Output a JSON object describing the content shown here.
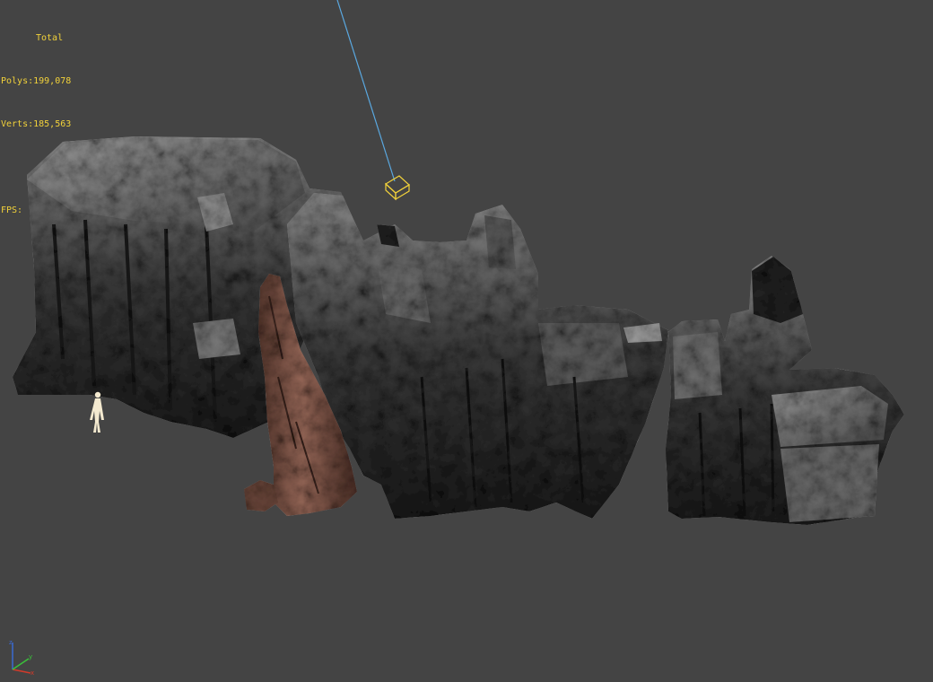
{
  "viewport": {
    "background": "#444444",
    "stats": {
      "title": "Total",
      "polys_label": "Polys:",
      "polys_value": "199,078",
      "verts_label": "Verts:",
      "verts_value": "185,563",
      "fps_label": "FPS:"
    },
    "colors": {
      "stats_text": "#f2d23a",
      "light_gizmo": "#f2d23a",
      "light_line": "#5aa8e0",
      "axis_x": "#d23a2a",
      "axis_y": "#3ac23a",
      "axis_z": "#3a6ad2"
    },
    "gizmo_axes": [
      "x",
      "y",
      "z"
    ]
  }
}
